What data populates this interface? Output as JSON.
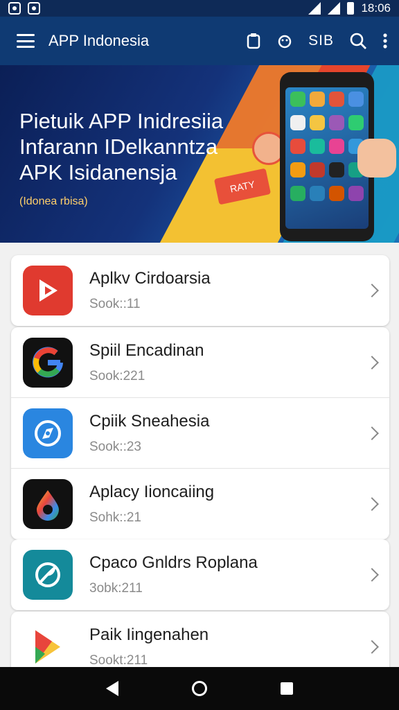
{
  "status_bar": {
    "time": "18:06"
  },
  "app_bar": {
    "title": "APP Indonesia",
    "action_text": "SIB"
  },
  "banner": {
    "headline_line1": "Pietuik APP Inidresiia",
    "headline_line2": "Infarann IDelkanntza",
    "headline_line3": "APK Isidanensja",
    "subtitle": "(Idonea rbisa)",
    "tag": "RATY"
  },
  "apps": [
    {
      "title": "Aplkv Cirdoarsia",
      "subtitle": "Sook::11",
      "icon": "play-icon",
      "color": "#e03a2f"
    },
    {
      "title": "Spiil Encadinan",
      "subtitle": "Sook:221",
      "icon": "google-g-icon",
      "color": "#111111"
    },
    {
      "title": "Cpiik Sneahesia",
      "subtitle": "Sook::23",
      "icon": "compass-icon",
      "color": "#2a86e0"
    },
    {
      "title": "Aplacy Iioncaiing",
      "subtitle": "Sohk::21",
      "icon": "drop-icon",
      "color": "#111111"
    },
    {
      "title": "Cpaco Gnldrs Roplana",
      "subtitle": "3obk:211",
      "icon": "leaf-icon",
      "color": "#148a9a"
    },
    {
      "title": "Paik Iingenahen",
      "subtitle": "Sookt:211",
      "icon": "play-store-icon",
      "color": "#ffffff"
    }
  ]
}
